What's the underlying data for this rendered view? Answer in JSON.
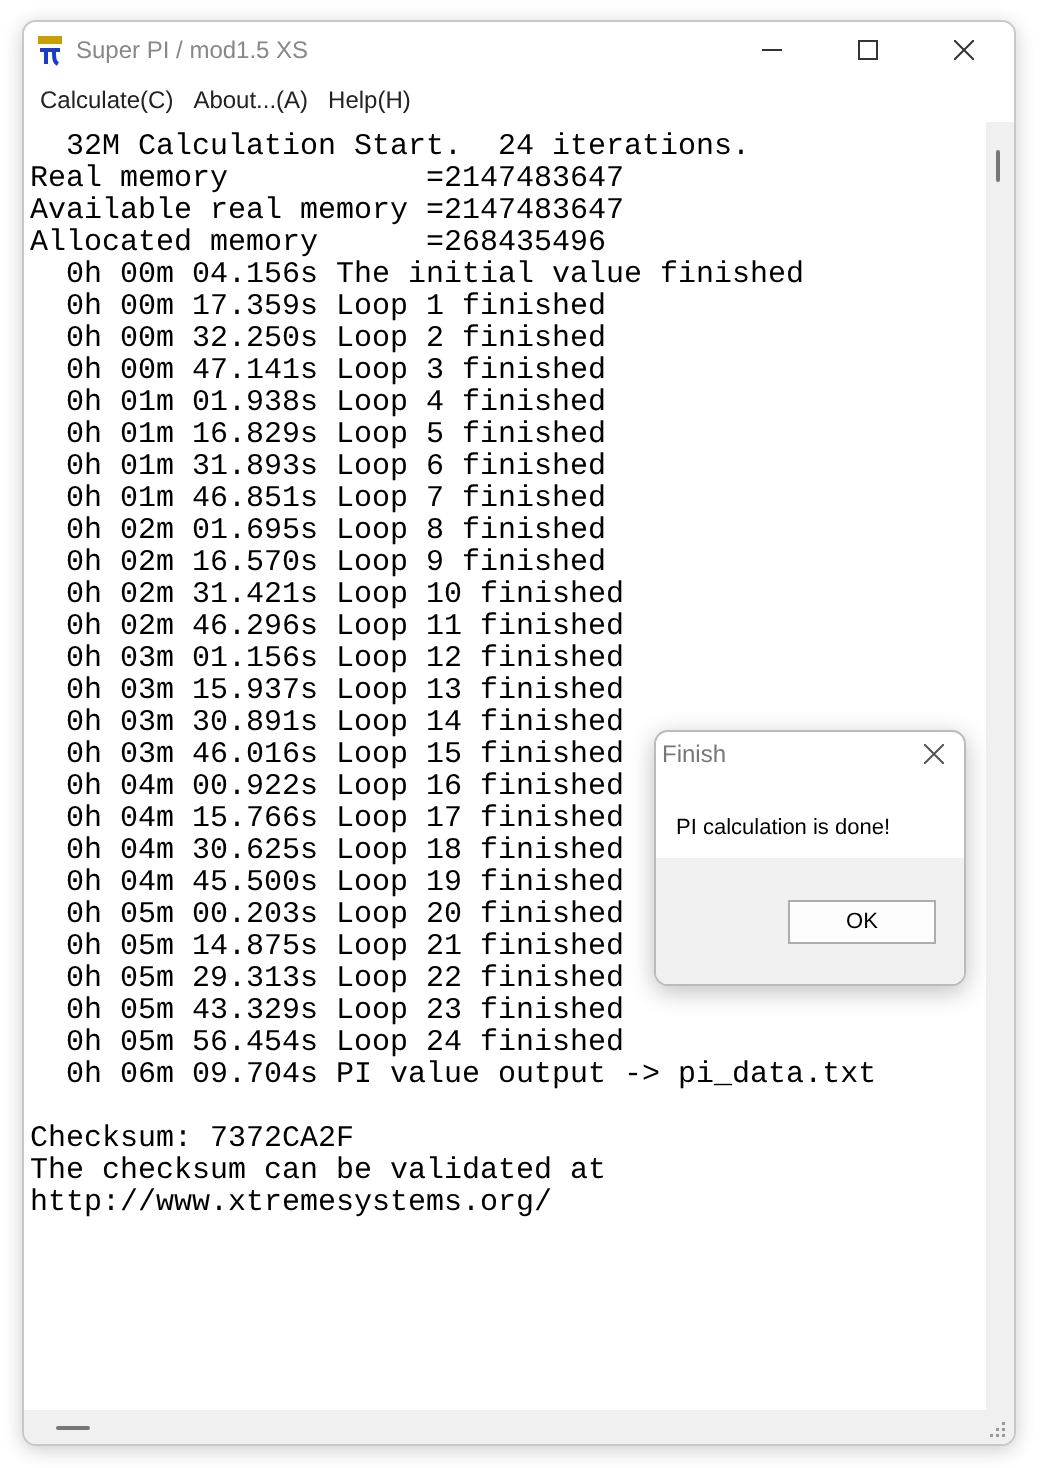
{
  "window": {
    "title": "Super PI / mod1.5 XS"
  },
  "menu": [
    "Calculate(C)",
    "About...(A)",
    "Help(H)"
  ],
  "output": {
    "log_lines": [
      "  32M Calculation Start.  24 iterations.",
      "Real memory           =2147483647",
      "Available real memory =2147483647",
      "Allocated memory      =268435496",
      "  0h 00m 04.156s The initial value finished",
      "  0h 00m 17.359s Loop 1 finished",
      "  0h 00m 32.250s Loop 2 finished",
      "  0h 00m 47.141s Loop 3 finished",
      "  0h 01m 01.938s Loop 4 finished",
      "  0h 01m 16.829s Loop 5 finished",
      "  0h 01m 31.893s Loop 6 finished",
      "  0h 01m 46.851s Loop 7 finished",
      "  0h 02m 01.695s Loop 8 finished",
      "  0h 02m 16.570s Loop 9 finished",
      "  0h 02m 31.421s Loop 10 finished",
      "  0h 02m 46.296s Loop 11 finished",
      "  0h 03m 01.156s Loop 12 finished",
      "  0h 03m 15.937s Loop 13 finished",
      "  0h 03m 30.891s Loop 14 finished",
      "  0h 03m 46.016s Loop 15 finished",
      "  0h 04m 00.922s Loop 16 finished",
      "  0h 04m 15.766s Loop 17 finished",
      "  0h 04m 30.625s Loop 18 finished",
      "  0h 04m 45.500s Loop 19 finished",
      "  0h 05m 00.203s Loop 20 finished",
      "  0h 05m 14.875s Loop 21 finished",
      "  0h 05m 29.313s Loop 22 finished",
      "  0h 05m 43.329s Loop 23 finished",
      "  0h 05m 56.454s Loop 24 finished",
      "  0h 06m 09.704s PI value output -> pi_data.txt"
    ],
    "checksum_lines": [
      "Checksum: 7372CA2F",
      "The checksum can be validated at",
      "http://www.xtremesystems.org/"
    ]
  },
  "dialog": {
    "title": "Finish",
    "message": "PI calculation is done!",
    "button": "OK"
  }
}
